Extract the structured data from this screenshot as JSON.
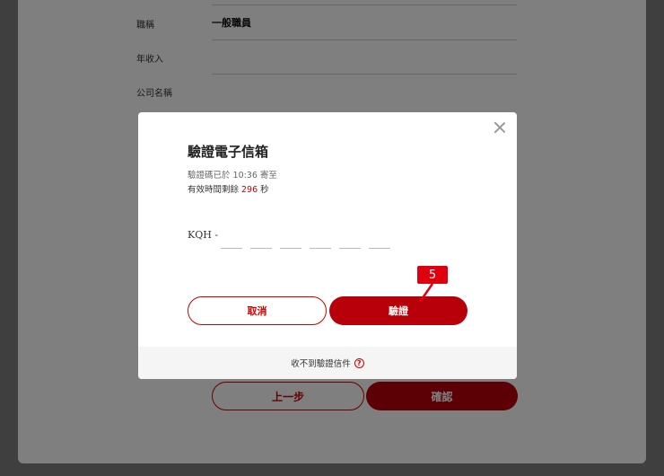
{
  "background": {
    "rows": [
      {
        "label": "職稱",
        "value": "一般職員"
      },
      {
        "label": "年收入",
        "value": ""
      },
      {
        "label": "公司名稱",
        "value": ""
      }
    ],
    "prev_label": "上一步",
    "confirm_label": "確認"
  },
  "modal": {
    "title": "驗證電子信箱",
    "sent_text": "驗證碼已於 10:36 寄至",
    "valid_prefix": "有效時間剩餘",
    "valid_seconds": "296",
    "valid_suffix": "秒",
    "code_prefix": "KQH -",
    "code_slots": [
      "",
      "",
      "",
      "",
      "",
      ""
    ],
    "cancel_label": "取消",
    "verify_label": "驗證",
    "footer_text": "收不到驗證信件",
    "help_glyph": "?"
  },
  "annotation": {
    "step": "5"
  },
  "colors": {
    "brand_red": "#b8000a",
    "badge_red": "#e0000d"
  }
}
